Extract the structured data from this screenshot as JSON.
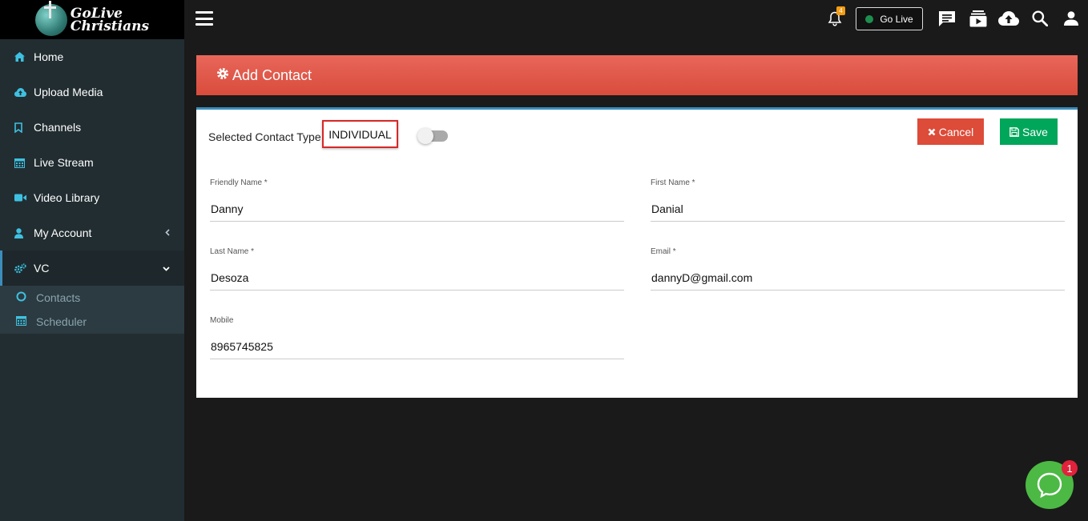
{
  "brand": {
    "line1": "GoLive",
    "line2": "Christians"
  },
  "sidebar": {
    "items": [
      {
        "label": "Home",
        "icon": "home-icon"
      },
      {
        "label": "Upload Media",
        "icon": "cloud-upload-icon"
      },
      {
        "label": "Channels",
        "icon": "bookmark-icon"
      },
      {
        "label": "Live Stream",
        "icon": "calendar-icon"
      },
      {
        "label": "Video Library",
        "icon": "video-icon"
      },
      {
        "label": "My Account",
        "icon": "user-icon"
      },
      {
        "label": "VC",
        "icon": "cogs-icon"
      }
    ],
    "subitems": [
      {
        "label": "Contacts",
        "icon": "circle-icon"
      },
      {
        "label": "Scheduler",
        "icon": "calendar-icon"
      }
    ]
  },
  "topbar": {
    "notification_count": "4",
    "golive_label": "Go Live"
  },
  "page": {
    "title": "Add Contact",
    "contact_type_label": "Selected Contact Type",
    "contact_type_value": "INDIVIDUAL",
    "cancel_label": "Cancel",
    "save_label": "Save"
  },
  "form": {
    "friendly_name": {
      "label": "Friendly Name *",
      "value": "Danny"
    },
    "first_name": {
      "label": "First Name *",
      "value": "Danial"
    },
    "last_name": {
      "label": "Last Name *",
      "value": "Desoza"
    },
    "email": {
      "label": "Email *",
      "value": "dannyD@gmail.com"
    },
    "mobile": {
      "label": "Mobile",
      "value": "8965745825"
    }
  },
  "chat": {
    "badge": "1"
  },
  "colors": {
    "sidebar_bg": "#222d32",
    "header_red": "#dd4b39",
    "save_green": "#00a65a",
    "accent_blue": "#3c8dbc",
    "icon_cyan": "#3ec1e0",
    "chat_green": "#4cb944"
  }
}
